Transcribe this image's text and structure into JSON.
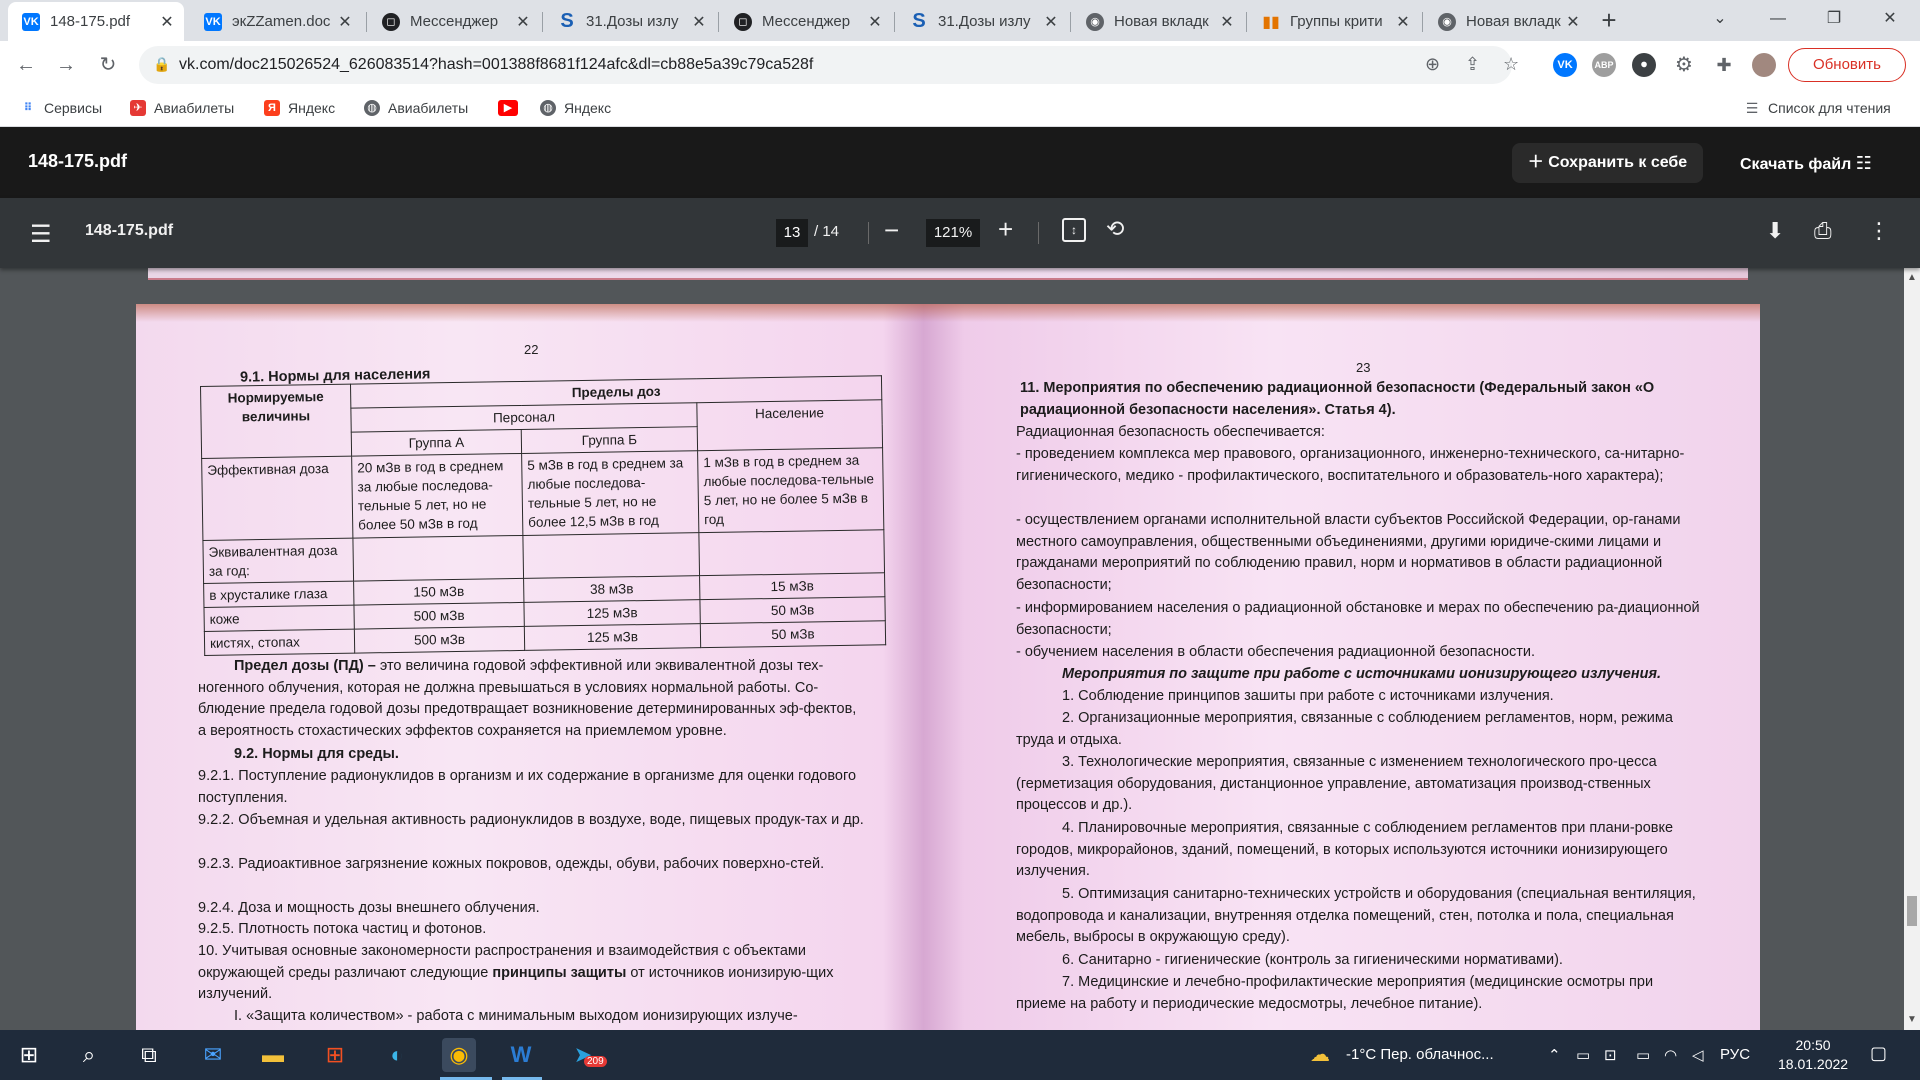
{
  "browser": {
    "tabs": [
      {
        "title": "148-175.pdf",
        "icon": "vk-icon",
        "color": "#0077ff",
        "active": true
      },
      {
        "title": "экZZamen.doc",
        "icon": "vk-icon",
        "color": "#0077ff"
      },
      {
        "title": "Мессенджер",
        "icon": "messenger-icon",
        "color": "#202124"
      },
      {
        "title": "31.Дозы излу",
        "icon": "s-icon",
        "color": "#1a5fb4"
      },
      {
        "title": "Мессенджер",
        "icon": "messenger-icon",
        "color": "#202124"
      },
      {
        "title": "31.Дозы излу",
        "icon": "s-icon",
        "color": "#1a5fb4"
      },
      {
        "title": "Новая вкладк",
        "icon": "chrome-icon",
        "color": "#5f6368"
      },
      {
        "title": "Группы крити",
        "icon": "chart-icon",
        "color": "#e37400"
      },
      {
        "title": "Новая вкладк",
        "icon": "chrome-icon",
        "color": "#5f6368"
      }
    ],
    "url": "vk.com/doc215026524_626083514?hash=001388f8681f124afc&dl=cb88e5a39c79ca528f",
    "update_label": "Обновить",
    "reading_list": "Список для чтения",
    "bookmarks": [
      {
        "label": "Сервисы",
        "icon": "apps-grid-icon",
        "color": "#4285f4"
      },
      {
        "label": "Авиабилеты",
        "icon": "bag-icon",
        "color": "#e53935"
      },
      {
        "label": "Яндекс",
        "icon": "yandex-icon",
        "color": "#fc3f1d"
      },
      {
        "label": "Авиабилеты",
        "icon": "globe-icon",
        "color": "#5f6368"
      },
      {
        "label": "",
        "icon": "youtube-icon",
        "color": "#ff0000"
      },
      {
        "label": "Яндекс",
        "icon": "globe-icon",
        "color": "#5f6368"
      }
    ]
  },
  "vk": {
    "filename": "148-175.pdf",
    "save_label": "Сохранить к себе",
    "download_label": "Скачать файл"
  },
  "viewer": {
    "title": "148-175.pdf",
    "page_current": "13",
    "page_total": "/ 14",
    "zoom": "121%"
  },
  "document": {
    "left_page_number": "22",
    "right_page_number": "23",
    "section_91": "9.1. Нормы для населения",
    "table": {
      "h_normed": "Нормируемые величины",
      "h_limits": "Пределы доз",
      "h_personnel": "Персонал",
      "h_population": "Население",
      "h_group_a": "Группа А",
      "h_group_b": "Группа Б",
      "r1_label": "Эффективная доза",
      "r1_a": "20 мЗв в год в среднем за любые последова-тельные 5 лет, но не более 50 мЗв в год",
      "r1_b": "5 мЗв в год в среднем за любые последова-тельные 5 лет, но не более 12,5 мЗв в год",
      "r1_p": "1 мЗв в год в среднем за любые последова-тельные 5 лет, но не более 5 мЗв в год",
      "r2_label": "Эквивалентная доза за год:",
      "r3_label": "в хрусталике глаза",
      "r3_a": "150 мЗв",
      "r3_b": "38 мЗв",
      "r3_p": "15 мЗв",
      "r4_label": "коже",
      "r4_a": "500 мЗв",
      "r4_b": "125 мЗв",
      "r4_p": "50 мЗв",
      "r5_label": "кистях, стопах",
      "r5_a": "500 мЗв",
      "r5_b": "125 мЗв",
      "r5_p": "50 мЗв"
    },
    "pd_term": "Предел дозы (ПД) –",
    "pd_text": "это величина годовой эффективной или эквивалентной дозы тех-ногенного облучения, которая не должна превышаться в условиях нормальной работы. Со-блюдение предела годовой дозы предотвращает возникновение детерминированных эф-фектов, а вероятность стохастических эффектов сохраняется на приемлемом уровне.",
    "section_92": "9.2. Нормы для среды.",
    "l_921": "9.2.1. Поступление радионуклидов в организм и их содержание в организме для оценки годового поступления.",
    "l_922": "9.2.2. Объемная и удельная активность радионуклидов в воздухе, воде, пищевых продук-тах и др.",
    "l_923": "9.2.3. Радиоактивное загрязнение кожных покровов, одежды, обуви, рабочих поверхно-стей.",
    "l_924": "9.2.4. Доза и мощность дозы внешнего облучения.",
    "l_925": "9.2.5. Плотность потока частиц и фотонов.",
    "l_10a": "10. Учитывая основные закономерности распространения и взаимодействия с объектами окружающей среды различают следующие",
    "l_10b": "принципы защиты",
    "l_10c": "от источников ионизирую-щих излучений.",
    "l_i": "I. «Защита количеством» - работа с минимальным выходом ионизирующих излуче-",
    "r_heading": "11. Мероприятия по обеспечению радиационной безопасности (Федеральный закон «О радиационной безопасности населения». Статья 4).",
    "r_intro": "Радиационная безопасность обеспечивается:",
    "r_b1": "- проведением комплекса мер правового, организационного, инженерно-технического, са-нитарно-гигиенического, медико - профилактического, воспитательного и образователь-ного характера);",
    "r_b2": "- осуществлением органами исполнительной власти субъектов Российской Федерации, ор-ганами местного самоуправления, общественными объединениями, другими юридиче-скими лицами и гражданами мероприятий по соблюдению правил, норм и нормативов в области радиационной безопасности;",
    "r_b3": "- информированием населения о радиационной обстановке и мерах по обеспечению ра-диационной безопасности;",
    "r_b4": "- обучением населения в области обеспечения радиационной безопасности.",
    "r_sub": "Мероприятия по защите при работе с источниками ионизирующего излучения.",
    "r_1": "1. Соблюдение принципов зашиты при работе с источниками излучения.",
    "r_2": "2. Организационные мероприятия, связанные с соблюдением регламентов, норм, режима труда и отдыха.",
    "r_3": "3. Технологические мероприятия, связанные с изменением технологического про-цесса (герметизация оборудования, дистанционное управление, автоматизация производ-ственных процессов и др.).",
    "r_4": "4. Планировочные мероприятия, связанные с соблюдением регламентов при плани-ровке городов, микрорайонов, зданий, помещений, в которых используются источники ионизирующего излучения.",
    "r_5": "5. Оптимизация санитарно-технических устройств и оборудования (специальная вентиляция, водопровода и канализации, внутренняя отделка помещений, стен, потолка и пола, специальная мебель, выбросы в окружающую среду).",
    "r_6": "6. Санитарно - гигиенические (контроль за гигиеническими нормативами).",
    "r_7": "7. Медицинские и лечебно-профилактические мероприятия (медицинские осмотры при приеме на работу и периодические медосмотры, лечебное питание)."
  },
  "taskbar": {
    "weather": "-1°C Пер. облачнос...",
    "language": "РУС",
    "time": "20:50",
    "date": "18.01.2022",
    "telegram_badge": "209"
  }
}
